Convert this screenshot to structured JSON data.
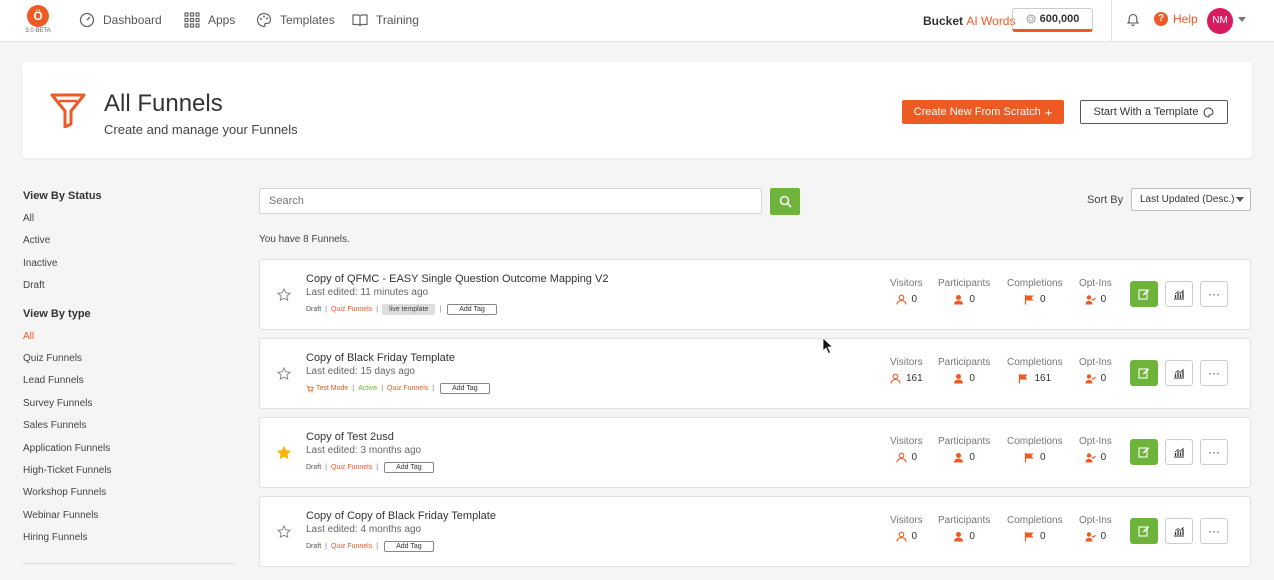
{
  "nav": {
    "logo_letter": "Ö",
    "logo_version": "3.0 BETA",
    "items": [
      {
        "label": "Dashboard",
        "icon": "gauge-icon"
      },
      {
        "label": "Apps",
        "icon": "grid-icon"
      },
      {
        "label": "Templates",
        "icon": "palette-icon"
      },
      {
        "label": "Training",
        "icon": "book-icon"
      }
    ],
    "bucket_label": "Bucket",
    "ai_words_label": "AI Words",
    "ai_words_count": "600,000",
    "help_label": "Help",
    "avatar_initials": "NM"
  },
  "header": {
    "title": "All Funnels",
    "subtitle": "Create and manage your Funnels",
    "create_button": "Create New From Scratch",
    "template_button": "Start With a Template"
  },
  "sidebar": {
    "status_heading": "View By Status",
    "status_items": [
      "All",
      "Active",
      "Inactive",
      "Draft"
    ],
    "type_heading": "View By type",
    "type_items": [
      "All",
      "Quiz Funnels",
      "Lead Funnels",
      "Survey Funnels",
      "Sales Funnels",
      "Application Funnels",
      "High-Ticket Funnels",
      "Workshop Funnels",
      "Webinar Funnels",
      "Hiring Funnels"
    ],
    "active_type": "All"
  },
  "search": {
    "placeholder": "Search"
  },
  "sort": {
    "label": "Sort By",
    "selected": "Last Updated (Desc.)"
  },
  "count_text": "You have 8 Funnels.",
  "stat_labels": [
    "Visitors",
    "Participants",
    "Completions",
    "Opt-Ins"
  ],
  "add_tag_label": "Add Tag",
  "funnels": [
    {
      "title": "Copy of QFMC - EASY Single Question Outcome Mapping V2",
      "edited": "Last edited: 11 minutes ago",
      "starred": false,
      "tags": [
        {
          "text": "Draft",
          "style": "plain"
        },
        {
          "text": "Quiz Funnels",
          "style": "orange"
        },
        {
          "text": "live template",
          "style": "pill"
        }
      ],
      "visitors": "0",
      "participants": "0",
      "completions": "0",
      "optins": "0"
    },
    {
      "title": "Copy of Black Friday Template",
      "edited": "Last edited: 15 days ago",
      "starred": false,
      "tags": [
        {
          "text": "Test Mode",
          "style": "orange-cart"
        },
        {
          "text": "Active",
          "style": "green"
        },
        {
          "text": "Quiz Funnels",
          "style": "orange"
        }
      ],
      "visitors": "161",
      "participants": "0",
      "completions": "161",
      "optins": "0"
    },
    {
      "title": "Copy of Test 2usd",
      "edited": "Last edited: 3 months ago",
      "starred": true,
      "tags": [
        {
          "text": "Draft",
          "style": "plain"
        },
        {
          "text": "Quiz Funnels",
          "style": "orange"
        }
      ],
      "visitors": "0",
      "participants": "0",
      "completions": "0",
      "optins": "0"
    },
    {
      "title": "Copy of Copy of Black Friday Template",
      "edited": "Last edited: 4 months ago",
      "starred": false,
      "tags": [
        {
          "text": "Draft",
          "style": "plain"
        },
        {
          "text": "Quiz Funnels",
          "style": "orange"
        }
      ],
      "visitors": "0",
      "participants": "0",
      "completions": "0",
      "optins": "0"
    }
  ],
  "colors": {
    "accent": "#ee5a24",
    "green": "#6fb43a",
    "avatar": "#d81b60",
    "star_filled": "#f4b400"
  }
}
